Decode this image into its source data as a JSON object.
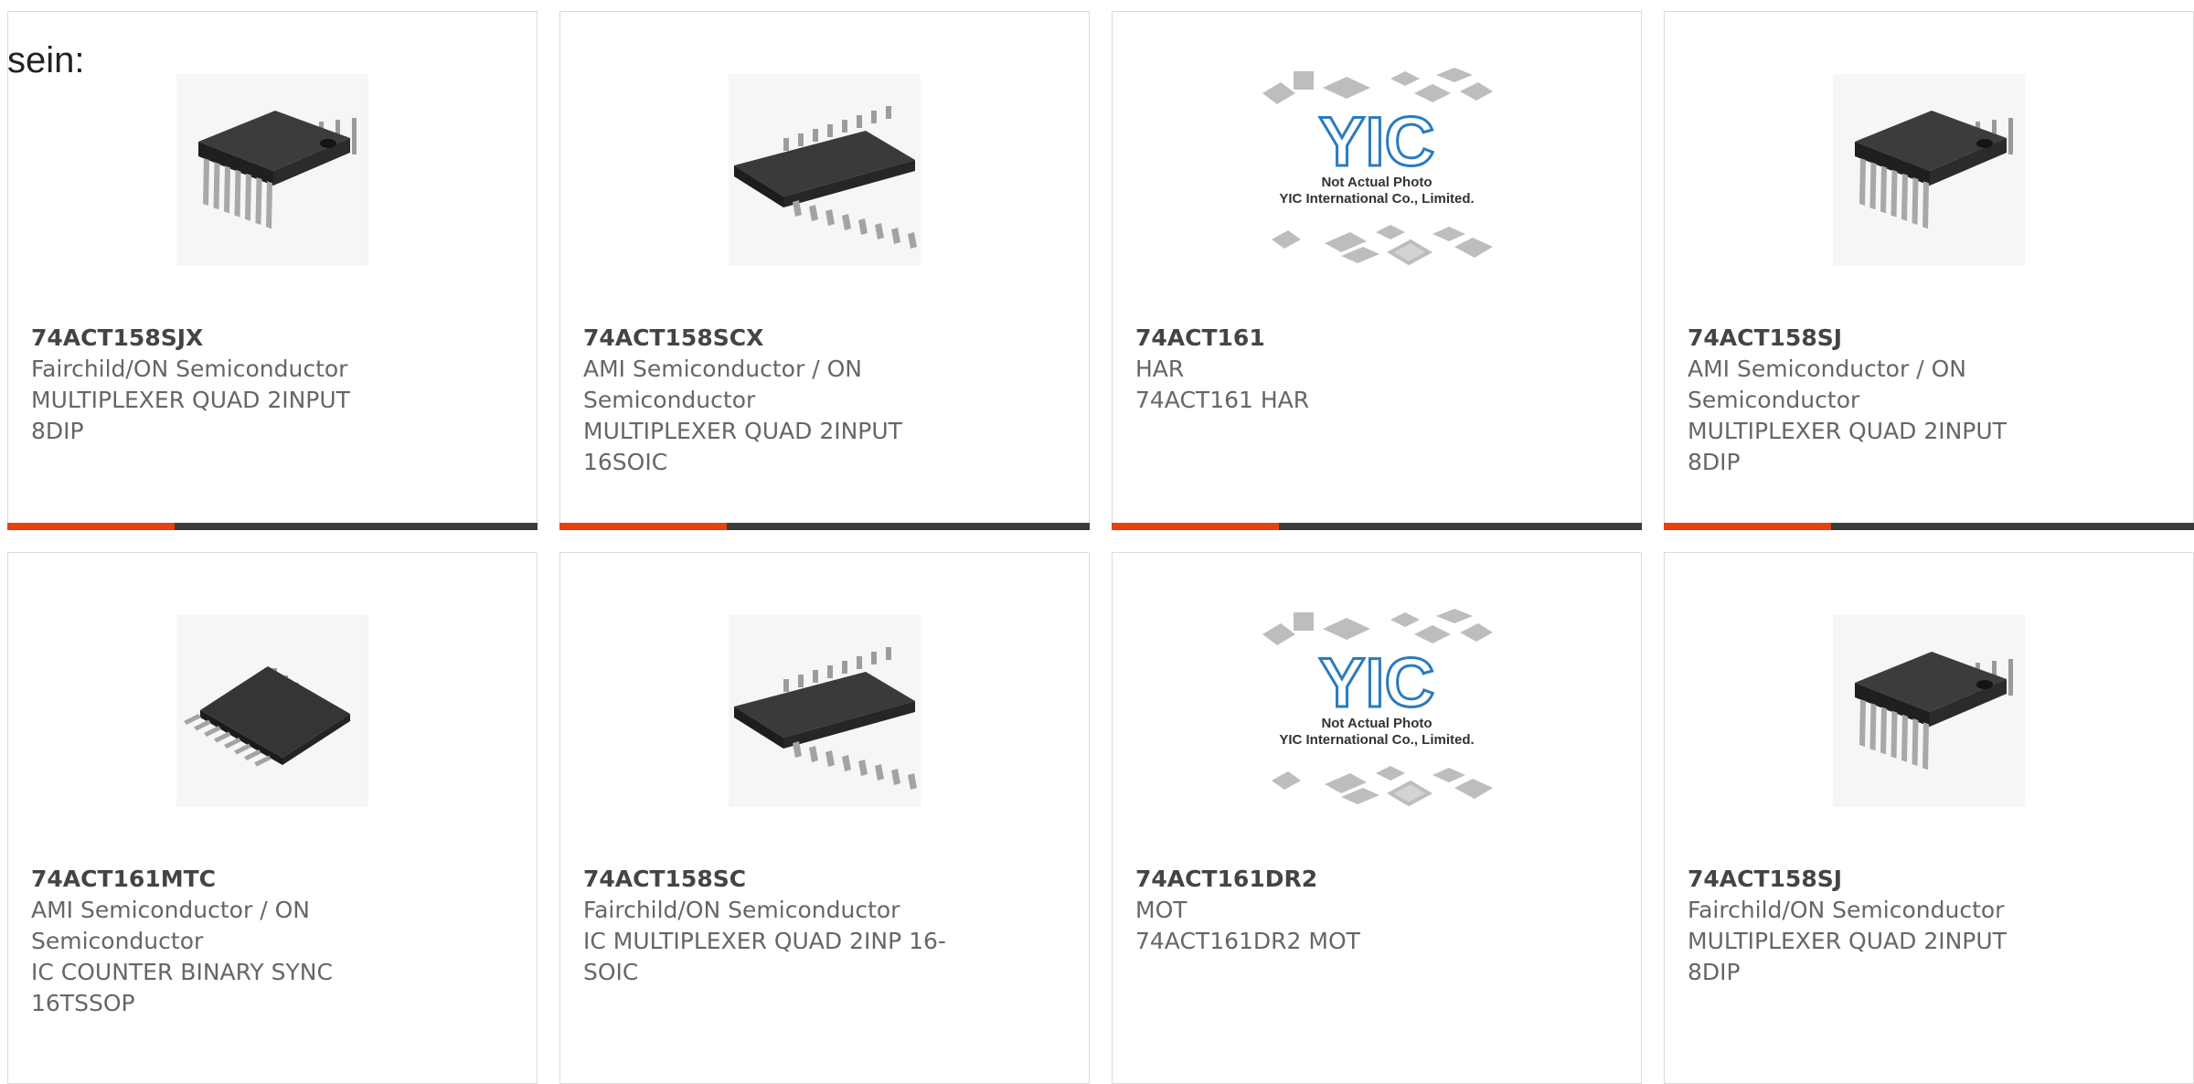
{
  "page": {
    "heading": "sein:"
  },
  "colors": {
    "accent": "#e8410e",
    "bar": "#3b3b3b",
    "border": "#dcdcdc"
  },
  "placeholder_text": {
    "line1": "Not Actual Photo",
    "line2": "YIC International Co., Limited.",
    "logo": "YIC"
  },
  "products": [
    {
      "part": "74ACT158SJX",
      "lines": [
        "Fairchild/ON Semiconductor",
        "MULTIPLEXER QUAD 2INPUT",
        "8DIP"
      ],
      "image": "dip-chip-icon"
    },
    {
      "part": "74ACT158SCX",
      "lines": [
        "AMI Semiconductor / ON",
        "Semiconductor",
        "MULTIPLEXER QUAD 2INPUT",
        "16SOIC"
      ],
      "image": "soic-chip-icon"
    },
    {
      "part": "74ACT161",
      "lines": [
        "HAR",
        "74ACT161 HAR"
      ],
      "image": "not-actual-photo-placeholder"
    },
    {
      "part": "74ACT158SJ",
      "lines": [
        "AMI Semiconductor / ON",
        "Semiconductor",
        "MULTIPLEXER QUAD 2INPUT",
        "8DIP"
      ],
      "image": "dip-chip-icon"
    },
    {
      "part": "74ACT161MTC",
      "lines": [
        "AMI Semiconductor / ON",
        "Semiconductor",
        "IC COUNTER BINARY SYNC",
        "16TSSOP"
      ],
      "image": "tssop-chip-icon"
    },
    {
      "part": "74ACT158SC",
      "lines": [
        "Fairchild/ON Semiconductor",
        "IC MULTIPLEXER QUAD 2INP 16-",
        "SOIC"
      ],
      "image": "soic-chip-icon"
    },
    {
      "part": "74ACT161DR2",
      "lines": [
        "MOT",
        "74ACT161DR2 MOT"
      ],
      "image": "not-actual-photo-placeholder"
    },
    {
      "part": "74ACT158SJ",
      "lines": [
        "Fairchild/ON Semiconductor",
        "MULTIPLEXER QUAD 2INPUT",
        "8DIP"
      ],
      "image": "dip-chip-icon"
    }
  ]
}
